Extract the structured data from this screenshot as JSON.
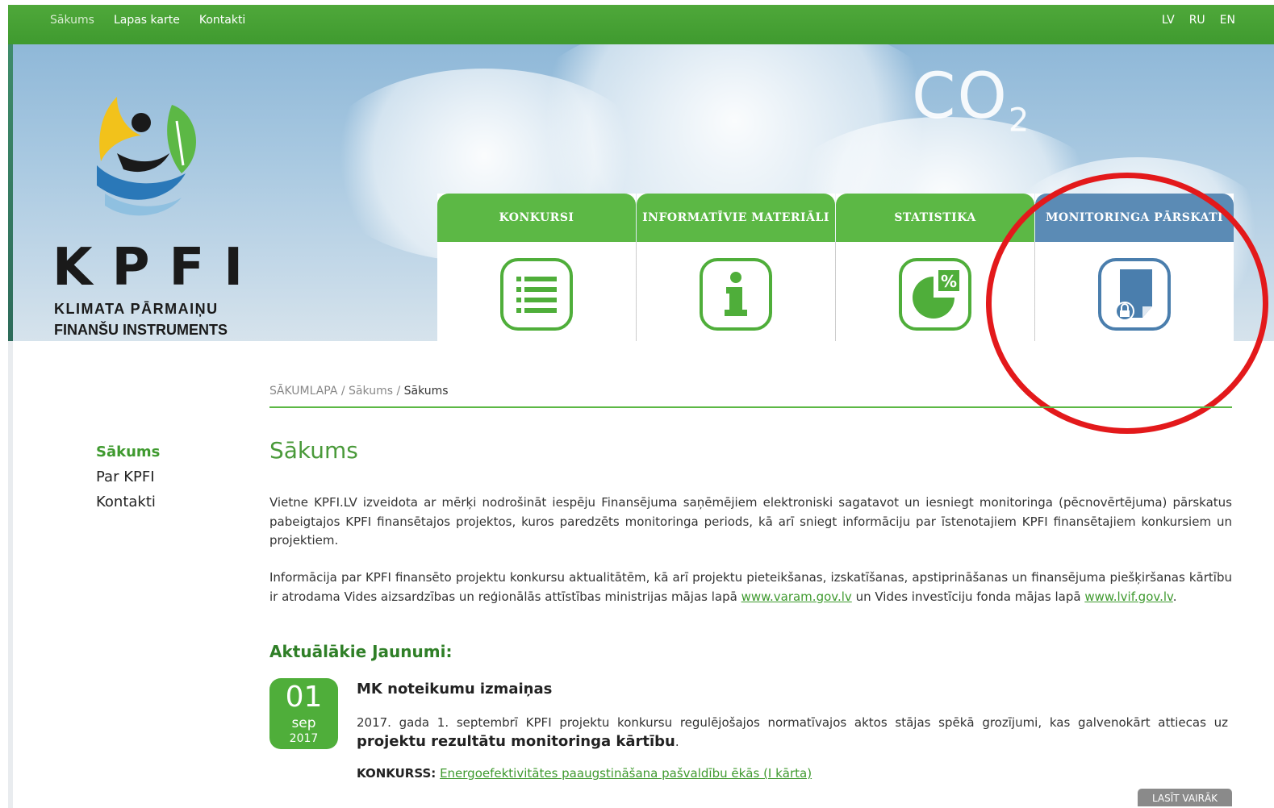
{
  "topnav": {
    "left": [
      "Sākums",
      "Lapas karte",
      "Kontakti"
    ],
    "langs": [
      "LV",
      "RU",
      "EN"
    ]
  },
  "logo": {
    "title": "KPFI",
    "line1": "KLIMATA PĀRMAIŅU",
    "line2": "FINANŠU INSTRUMENTS"
  },
  "hero": {
    "co2": "CO",
    "co2_sub": "2"
  },
  "tiles": [
    {
      "label": "KONKURSI",
      "icon": "list-icon",
      "accent": "#5cb845"
    },
    {
      "label": "INFORMATĪVIE MATERIĀLI",
      "icon": "info-icon",
      "accent": "#5cb845"
    },
    {
      "label": "STATISTIKA",
      "icon": "pie-chart-percent-icon",
      "accent": "#5cb845"
    },
    {
      "label": "MONITORINGA PĀRSKATI",
      "icon": "locked-document-icon",
      "accent": "#5b8bb5"
    }
  ],
  "breadcrumb": {
    "root": "SĀKUMLAPA",
    "sep": "/",
    "mid": "Sākums",
    "current": "Sākums"
  },
  "sidenav": [
    "Sākums",
    "Par KPFI",
    "Kontakti"
  ],
  "page_title": "Sākums",
  "para1": "Vietne KPFI.LV izveidota ar mērķi nodrošināt iespēju Finansējuma saņēmējiem elektroniski sagatavot un iesniegt monitoringa (pēcnovērtējuma) pārskatus pabeigtajos KPFI finansētajos projektos, kuros paredzēts monitoringa periods, kā arī sniegt informāciju par īstenotajiem KPFI finansētajiem konkursiem un projektiem.",
  "para2": {
    "text_a": "Informācija par KPFI finansēto projektu konkursu aktualitātēm, kā arī projektu pieteikšanas, izskatīšanas, apstiprināšanas un finansējuma piešķiršanas kārtību ir atrodama Vides aizsardzības un reģionālās attīstības ministrijas mājas lapā ",
    "link1": "www.varam.gov.lv",
    "text_b": " un Vides investīciju fonda mājas lapā ",
    "link2": "www.lvif.gov.lv",
    "text_c": "."
  },
  "news_heading": "Aktuālākie Jaunumi:",
  "news": {
    "day": "01",
    "month": "sep",
    "year": "2017",
    "title": "MK noteikumu izmaiņas",
    "body": "2017. gada 1. septembrī KPFI projektu konkursu regulējošajos normatīvajos aktos stājas spēkā grozījumi, kas galvenokārt attiecas uz ",
    "body_bold": "projektu rezultātu monitoringa kārtību",
    "body_end": ".",
    "contest_label": "KONKURSS:",
    "contest_link": "Energoefektivitātes paaugstināšana pašvaldību ēkās (I kārta)",
    "read_more": "LASĪT VAIRĀK"
  },
  "colors": {
    "brand_green": "#4fae3a",
    "monitor_blue": "#5b8bb5",
    "highlight_red": "#e3191b"
  }
}
